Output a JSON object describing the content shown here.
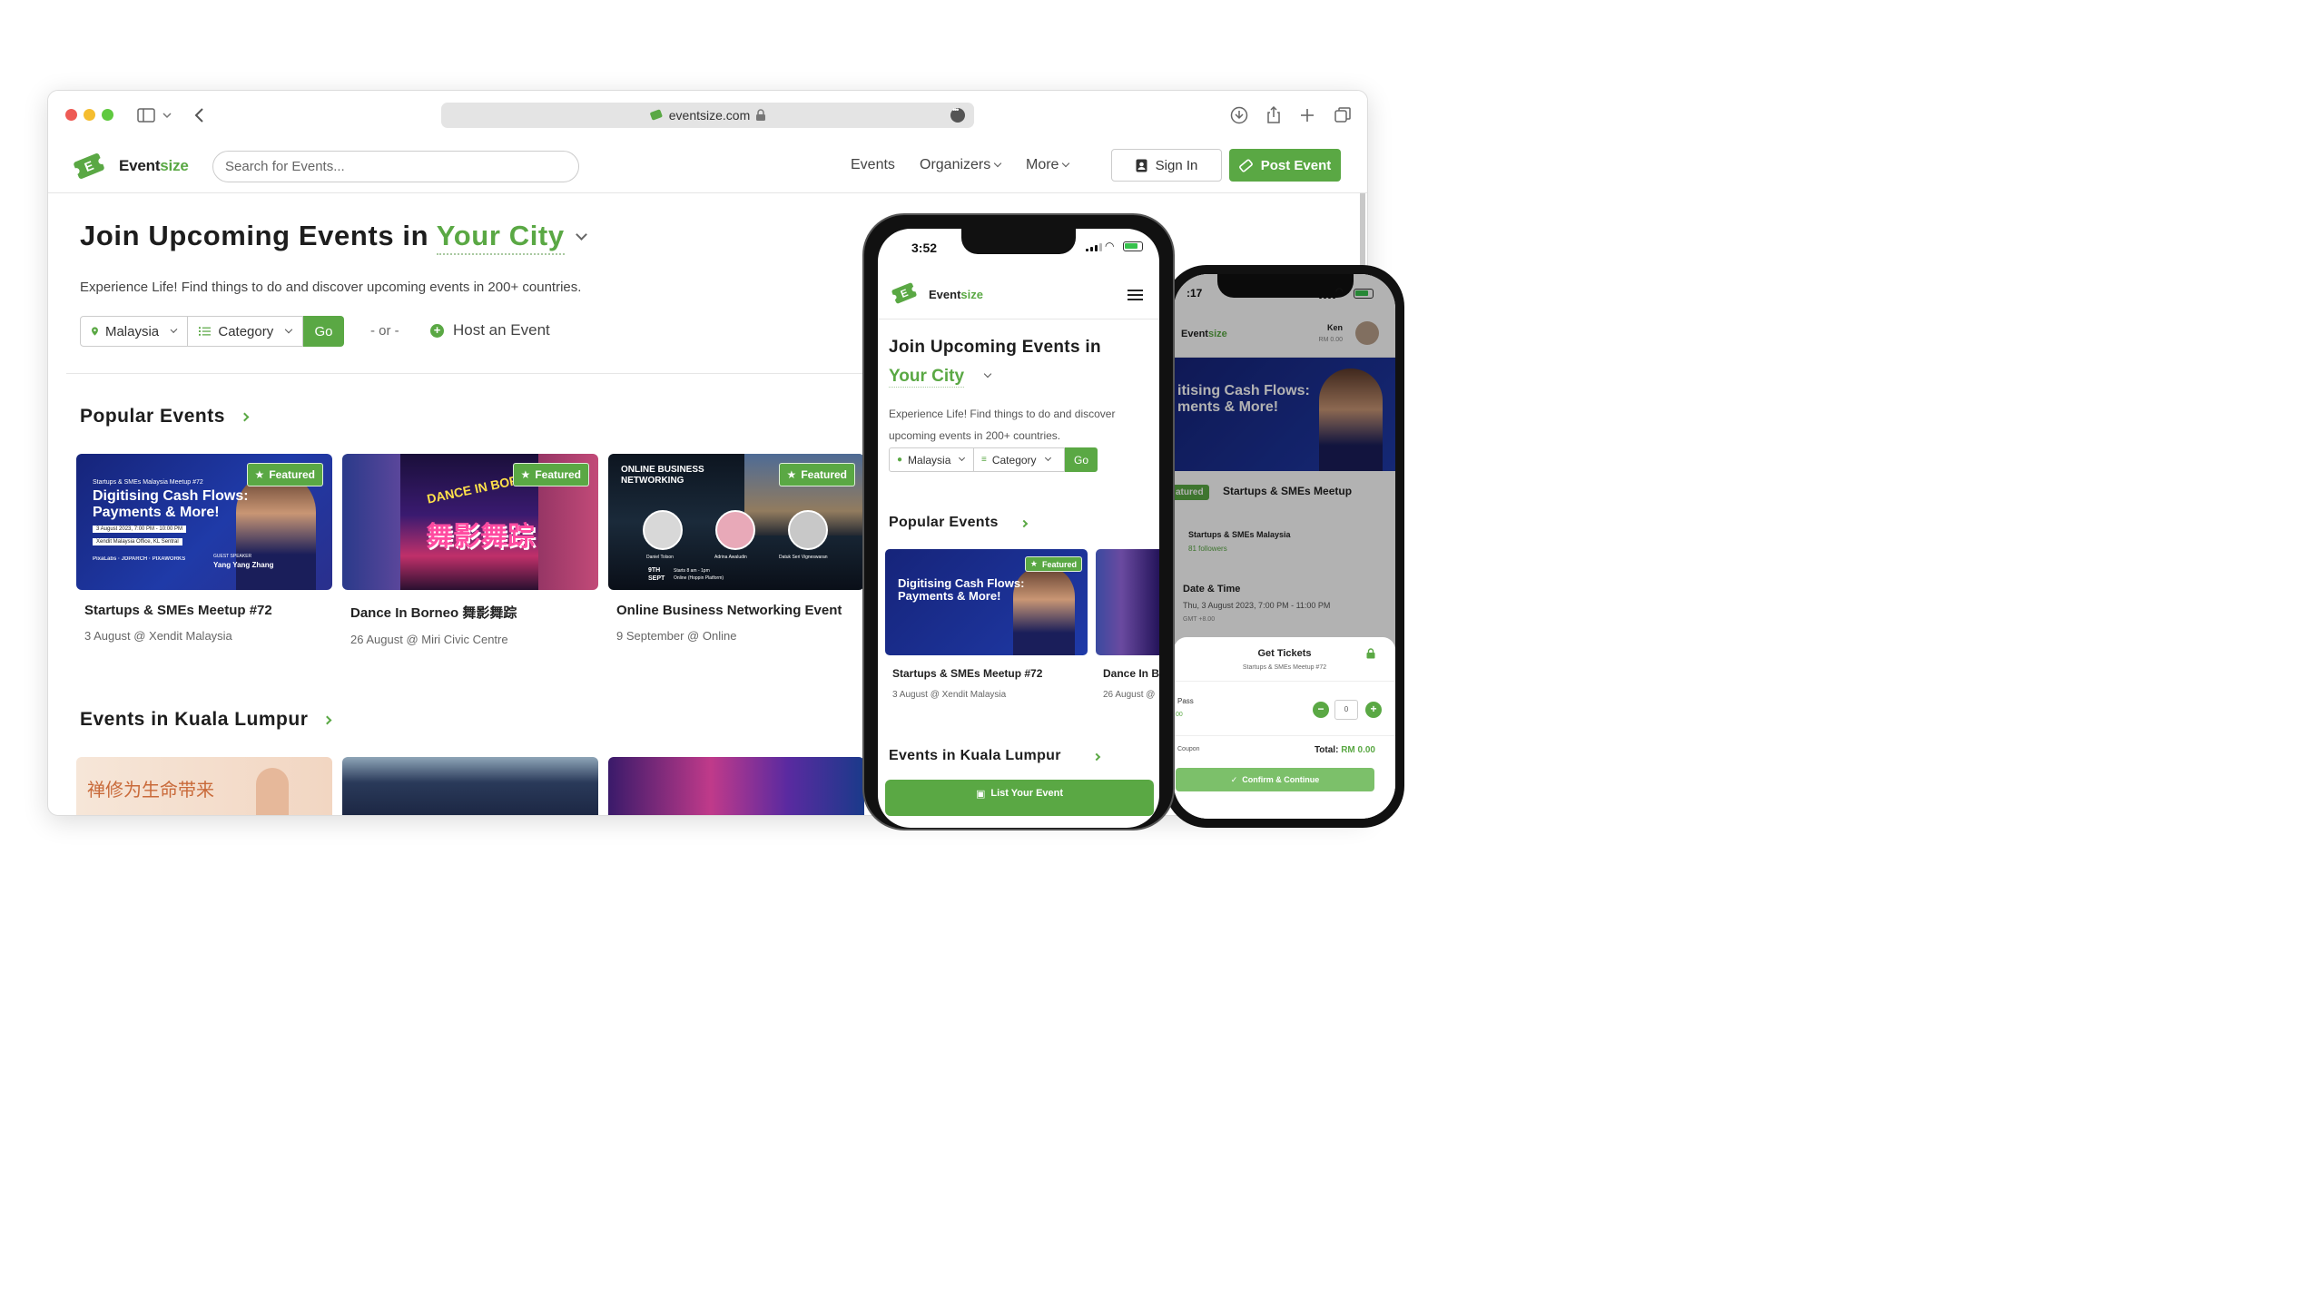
{
  "browser": {
    "url": "eventsize.com"
  },
  "site": {
    "brand_main": "Event",
    "brand_accent": "size",
    "search_placeholder": "Search for Events...",
    "nav": {
      "events": "Events",
      "organizers": "Organizers",
      "more": "More"
    },
    "sign_in": "Sign In",
    "post_event": "Post Event"
  },
  "hero": {
    "title_prefix": "Join Upcoming Events in",
    "title_city": "Your City",
    "subtitle": "Experience Life! Find things to do and discover upcoming events in 200+ countries.",
    "country": "Malaysia",
    "category": "Category",
    "go": "Go",
    "or": "- or -",
    "host": "Host an Event"
  },
  "popular": {
    "title": "Popular Events",
    "featured_label": "Featured",
    "events": [
      {
        "title": "Startups & SMEs Meetup #72",
        "meta": "3 August @ Xendit Malaysia",
        "poster_kicker": "Startups & SMEs Malaysia Meetup #72",
        "poster_headline_1": "Digitising Cash Flows:",
        "poster_headline_2": "Payments & More!",
        "poster_date": "3 August 2023, 7:00 PM - 10:00 PM",
        "poster_venue": "Xendit Malaysia Office, KL Sentral",
        "poster_speaker_label": "GUEST SPEAKER",
        "poster_speaker": "Yang Yang Zhang"
      },
      {
        "title": "Dance In Borneo 舞影舞踪",
        "meta": "26 August @ Miri Civic Centre",
        "poster_headline_1": "DANCE IN BORNEO",
        "poster_headline_2": "舞影舞踪"
      },
      {
        "title": "Online Business Networking Event",
        "meta": "9 September @ Online",
        "poster_headline_1": "ONLINE BUSINESS",
        "poster_headline_2": "NETWORKING",
        "poster_date_1": "9TH",
        "poster_date_2": "SEPT",
        "poster_time": "Starts 8 am - 1pm",
        "poster_platform": "Online (Hoppin Platform)",
        "speakers": [
          "Daniel Tolson",
          "Adrina Awaludin",
          "Datuk Seri Vigneswaran"
        ]
      }
    ]
  },
  "kl": {
    "title": "Events in Kuala Lumpur",
    "first_poster_text": "禅修为生命带来"
  },
  "phone1": {
    "time": "3:52",
    "brand_main": "Event",
    "brand_accent": "size",
    "title_line": "Join Upcoming Events in",
    "city": "Your City",
    "subtitle": "Experience Life! Find things to do and discover upcoming events in 200+ countries.",
    "country": "Malaysia",
    "category": "Category",
    "go": "Go",
    "popular": "Popular Events",
    "featured": "Featured",
    "card1_title": "Startups & SMEs Meetup #72",
    "card1_meta": "3 August @ Xendit Malaysia",
    "card2_title": "Dance In B",
    "card2_meta": "26 August @",
    "kl": "Events in Kuala Lumpur",
    "list_event": "List Your Event"
  },
  "phone2": {
    "time": ":17",
    "brand_main": "Event",
    "brand_accent": "size",
    "user_name": "Ken",
    "user_balance": "RM 0.00",
    "poster_line1": "itising Cash Flows:",
    "poster_line2": "ments & More!",
    "featured_partial": "atured",
    "event_title": "Startups & SMEs Meetup",
    "organizer": "Startups & SMEs Malaysia",
    "followers": "81 followers",
    "date_label": "Date & Time",
    "date_value": "Thu, 3 August 2023, 7:00 PM - 11:00 PM",
    "tz": "GMT +8.00",
    "sheet_title": "Get Tickets",
    "sheet_sub": "Startups & SMEs Meetup #72",
    "ticket_name": "Pass",
    "ticket_price": "00",
    "qty": "0",
    "coupon": "Coupon",
    "total_label": "Total:",
    "total_value": "RM 0.00",
    "confirm": "Confirm & Continue"
  },
  "colors": {
    "brand_green": "#5aa844",
    "text_dark": "#1d1d1d",
    "muted": "#666666"
  }
}
